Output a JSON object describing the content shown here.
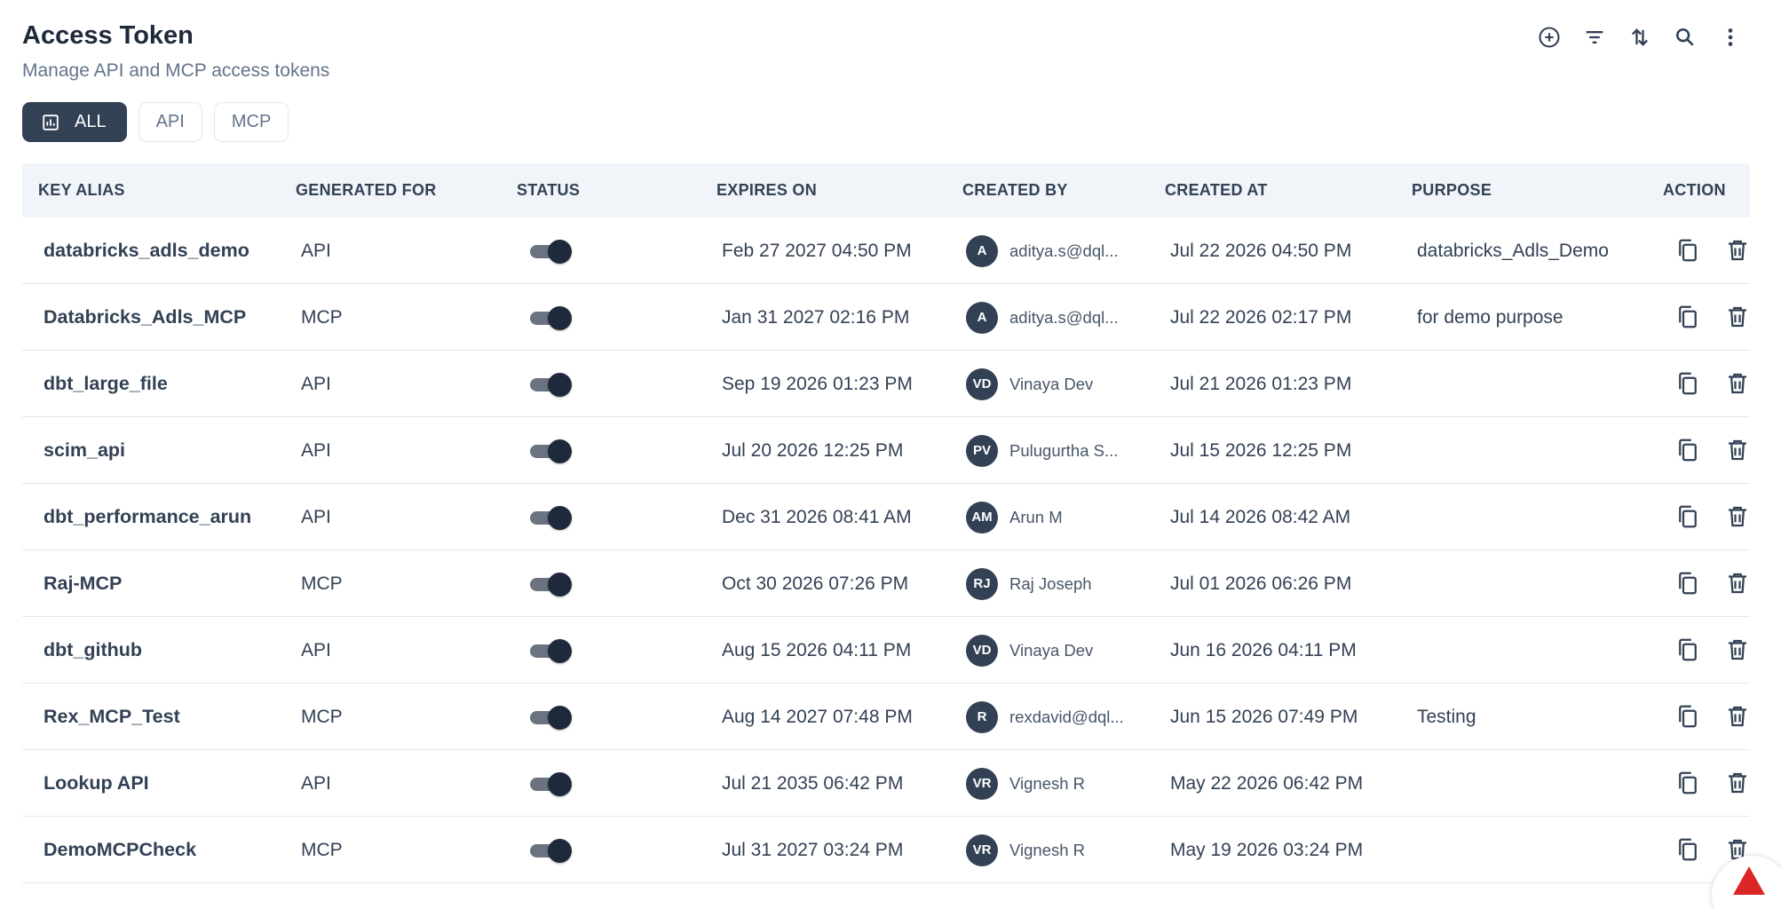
{
  "header": {
    "title": "Access Token",
    "subtitle": "Manage API and MCP access tokens"
  },
  "toolbar": {
    "icons": [
      "add-circle-icon",
      "filter-icon",
      "sort-icon",
      "search-icon",
      "more-vertical-icon"
    ]
  },
  "tabs": [
    {
      "label": "ALL",
      "active": true,
      "icon": "chart-icon"
    },
    {
      "label": "API",
      "active": false
    },
    {
      "label": "MCP",
      "active": false
    }
  ],
  "table": {
    "columns": [
      "KEY ALIAS",
      "GENERATED FOR",
      "STATUS",
      "EXPIRES ON",
      "CREATED BY",
      "CREATED AT",
      "PURPOSE",
      "ACTION"
    ],
    "rows": [
      {
        "alias": "databricks_adls_demo",
        "generated_for": "API",
        "status": true,
        "expires_on": "Feb 27 2027 04:50 PM",
        "avatar": "A",
        "created_by": "aditya.s@dql...",
        "created_at": "Jul 22 2026 04:50 PM",
        "purpose": "databricks_Adls_Demo"
      },
      {
        "alias": "Databricks_Adls_MCP",
        "generated_for": "MCP",
        "status": true,
        "expires_on": "Jan 31 2027 02:16 PM",
        "avatar": "A",
        "created_by": "aditya.s@dql...",
        "created_at": "Jul 22 2026 02:17 PM",
        "purpose": "for demo purpose"
      },
      {
        "alias": "dbt_large_file",
        "generated_for": "API",
        "status": true,
        "expires_on": "Sep 19 2026 01:23 PM",
        "avatar": "VD",
        "created_by": "Vinaya Dev",
        "created_at": "Jul 21 2026 01:23 PM",
        "purpose": ""
      },
      {
        "alias": "scim_api",
        "generated_for": "API",
        "status": true,
        "expires_on": "Jul 20 2026 12:25 PM",
        "avatar": "PV",
        "created_by": "Pulugurtha S...",
        "created_at": "Jul 15 2026 12:25 PM",
        "purpose": ""
      },
      {
        "alias": "dbt_performance_arun",
        "generated_for": "API",
        "status": true,
        "expires_on": "Dec 31 2026 08:41 AM",
        "avatar": "AM",
        "created_by": "Arun M",
        "created_at": "Jul 14 2026 08:42 AM",
        "purpose": ""
      },
      {
        "alias": "Raj-MCP",
        "generated_for": "MCP",
        "status": true,
        "expires_on": "Oct 30 2026 07:26 PM",
        "avatar": "RJ",
        "created_by": "Raj Joseph",
        "created_at": "Jul 01 2026 06:26 PM",
        "purpose": ""
      },
      {
        "alias": "dbt_github",
        "generated_for": "API",
        "status": true,
        "expires_on": "Aug 15 2026 04:11 PM",
        "avatar": "VD",
        "created_by": "Vinaya Dev",
        "created_at": "Jun 16 2026 04:11 PM",
        "purpose": ""
      },
      {
        "alias": "Rex_MCP_Test",
        "generated_for": "MCP",
        "status": true,
        "expires_on": "Aug 14 2027 07:48 PM",
        "avatar": "R",
        "created_by": "rexdavid@dql...",
        "created_at": "Jun 15 2026 07:49 PM",
        "purpose": "Testing"
      },
      {
        "alias": "Lookup API",
        "generated_for": "API",
        "status": true,
        "expires_on": "Jul 21 2035 06:42 PM",
        "avatar": "VR",
        "created_by": "Vignesh R",
        "created_at": "May 22 2026 06:42 PM",
        "purpose": ""
      },
      {
        "alias": "DemoMCPCheck",
        "generated_for": "MCP",
        "status": true,
        "expires_on": "Jul 31 2027 03:24 PM",
        "avatar": "VR",
        "created_by": "Vignesh R",
        "created_at": "May 19 2026 03:24 PM",
        "purpose": ""
      }
    ]
  },
  "colors": {
    "accent": "#334155",
    "header_bg": "#f1f5f9",
    "warning_red": "#dc2626"
  }
}
